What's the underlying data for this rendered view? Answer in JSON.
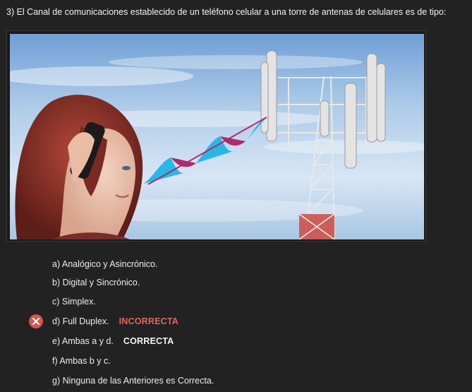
{
  "question": {
    "text": "3) El Canal de comunicaciones establecido de un teléfono celular a una torre de antenas de celulares es de tipo:"
  },
  "image": {
    "icon": "phone-to-cell-tower-illustration"
  },
  "options": [
    {
      "label": "a) Analógico y Asincrónico.",
      "verdict": ""
    },
    {
      "label": "b) Digital y Sincrónico.",
      "verdict": ""
    },
    {
      "label": "c) Simplex.",
      "verdict": ""
    },
    {
      "label": "d) Full Duplex.",
      "verdict": "INCORRECTA"
    },
    {
      "label": "e) Ambas a y d.",
      "verdict": "CORRECTA"
    },
    {
      "label": "f) Ambas b y c.",
      "verdict": ""
    },
    {
      "label": "g) Ninguna de las Anteriores es Correcta.",
      "verdict": ""
    }
  ],
  "colors": {
    "background": "#222222",
    "incorrect": "#e2665f",
    "incorrect_icon": "#d9534f",
    "correct": "#f4f4f4"
  }
}
